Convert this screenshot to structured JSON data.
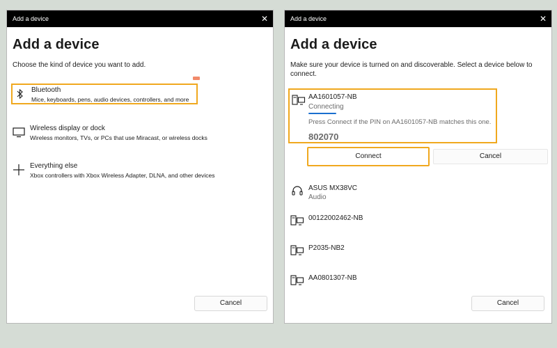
{
  "left_dialog": {
    "window_title": "Add a device",
    "close_glyph": "✕",
    "heading": "Add a device",
    "subtext": "Choose the kind of device you want to add.",
    "options": [
      {
        "title": "Bluetooth",
        "desc": "Mice, keyboards, pens, audio devices, controllers, and more",
        "icon": "bluetooth-icon",
        "highlighted": true
      },
      {
        "title": "Wireless display or dock",
        "desc": "Wireless monitors, TVs, or PCs that use Miracast, or wireless docks",
        "icon": "monitor-icon"
      },
      {
        "title": "Everything else",
        "desc": "Xbox controllers with Xbox Wireless Adapter, DLNA, and other devices",
        "icon": "plus-icon"
      }
    ],
    "cancel_label": "Cancel"
  },
  "right_dialog": {
    "window_title": "Add a device",
    "close_glyph": "✕",
    "heading": "Add a device",
    "subtext": "Make sure your device is turned on and discoverable. Select a device below to connect.",
    "selected_device": {
      "name": "AA1601057-NB",
      "status": "Connecting",
      "pin_message": "Press Connect if the PIN on AA1601057-NB matches this one.",
      "pin": "802070",
      "icon": "computer-icon"
    },
    "connect_label": "Connect",
    "cancel_inline_label": "Cancel",
    "devices": [
      {
        "name": "ASUS MX38VC",
        "sub": "Audio",
        "icon": "headphones-icon"
      },
      {
        "name": "00122002462-NB",
        "sub": "",
        "icon": "computer-icon"
      },
      {
        "name": "P2035-NB2",
        "sub": "",
        "icon": "computer-icon"
      },
      {
        "name": "AA0801307-NB",
        "sub": "",
        "icon": "computer-icon"
      }
    ],
    "cancel_label": "Cancel"
  },
  "colors": {
    "highlight": "#f0a81e",
    "titlebar": "#000000",
    "progress": "#1a6fcf",
    "background": "#d5dcd5"
  }
}
